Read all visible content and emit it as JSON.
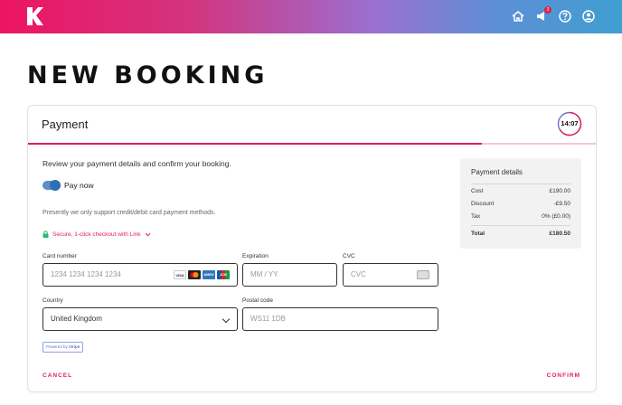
{
  "header": {
    "logo": "k-logo",
    "icons": [
      "home-icon",
      "megaphone-icon",
      "help-icon",
      "account-icon"
    ],
    "notification_count": "3"
  },
  "page": {
    "title": "NEW BOOKING"
  },
  "payment": {
    "title": "Payment",
    "timer": "14:07",
    "step_progress": 0.8,
    "intro": "Review your payment details and confirm your booking.",
    "toggle_label": "Pay now",
    "notice": "Presently we only support credit/debit card payment methods.",
    "secure_link": "Secure, 1-click checkout with Link",
    "card_number": {
      "label": "Card number",
      "placeholder": "1234 1234 1234 1234"
    },
    "card_brands": [
      "VISA",
      "MC",
      "AMEX",
      "JCB"
    ],
    "expiration": {
      "label": "Expiration",
      "placeholder": "MM / YY"
    },
    "cvc": {
      "label": "CVC",
      "placeholder": "CVC"
    },
    "country": {
      "label": "Country",
      "value": "United Kingdom"
    },
    "postal": {
      "label": "Postal code",
      "placeholder": "WS11 1DB"
    },
    "powered_by": "Powered by",
    "powered_brand": "stripe",
    "cancel": "CANCEL",
    "confirm": "CONFIRM"
  },
  "summary": {
    "title": "Payment details",
    "rows": [
      {
        "label": "Cost",
        "value": "£190.00"
      },
      {
        "label": "Discount",
        "value": "-£9.50"
      },
      {
        "label": "Tax",
        "value": "0% (£0.00)"
      }
    ],
    "total": {
      "label": "Total",
      "value": "£180.50"
    }
  },
  "colors": {
    "accent": "#e11d5a",
    "toggle": "#2f6fb3"
  }
}
